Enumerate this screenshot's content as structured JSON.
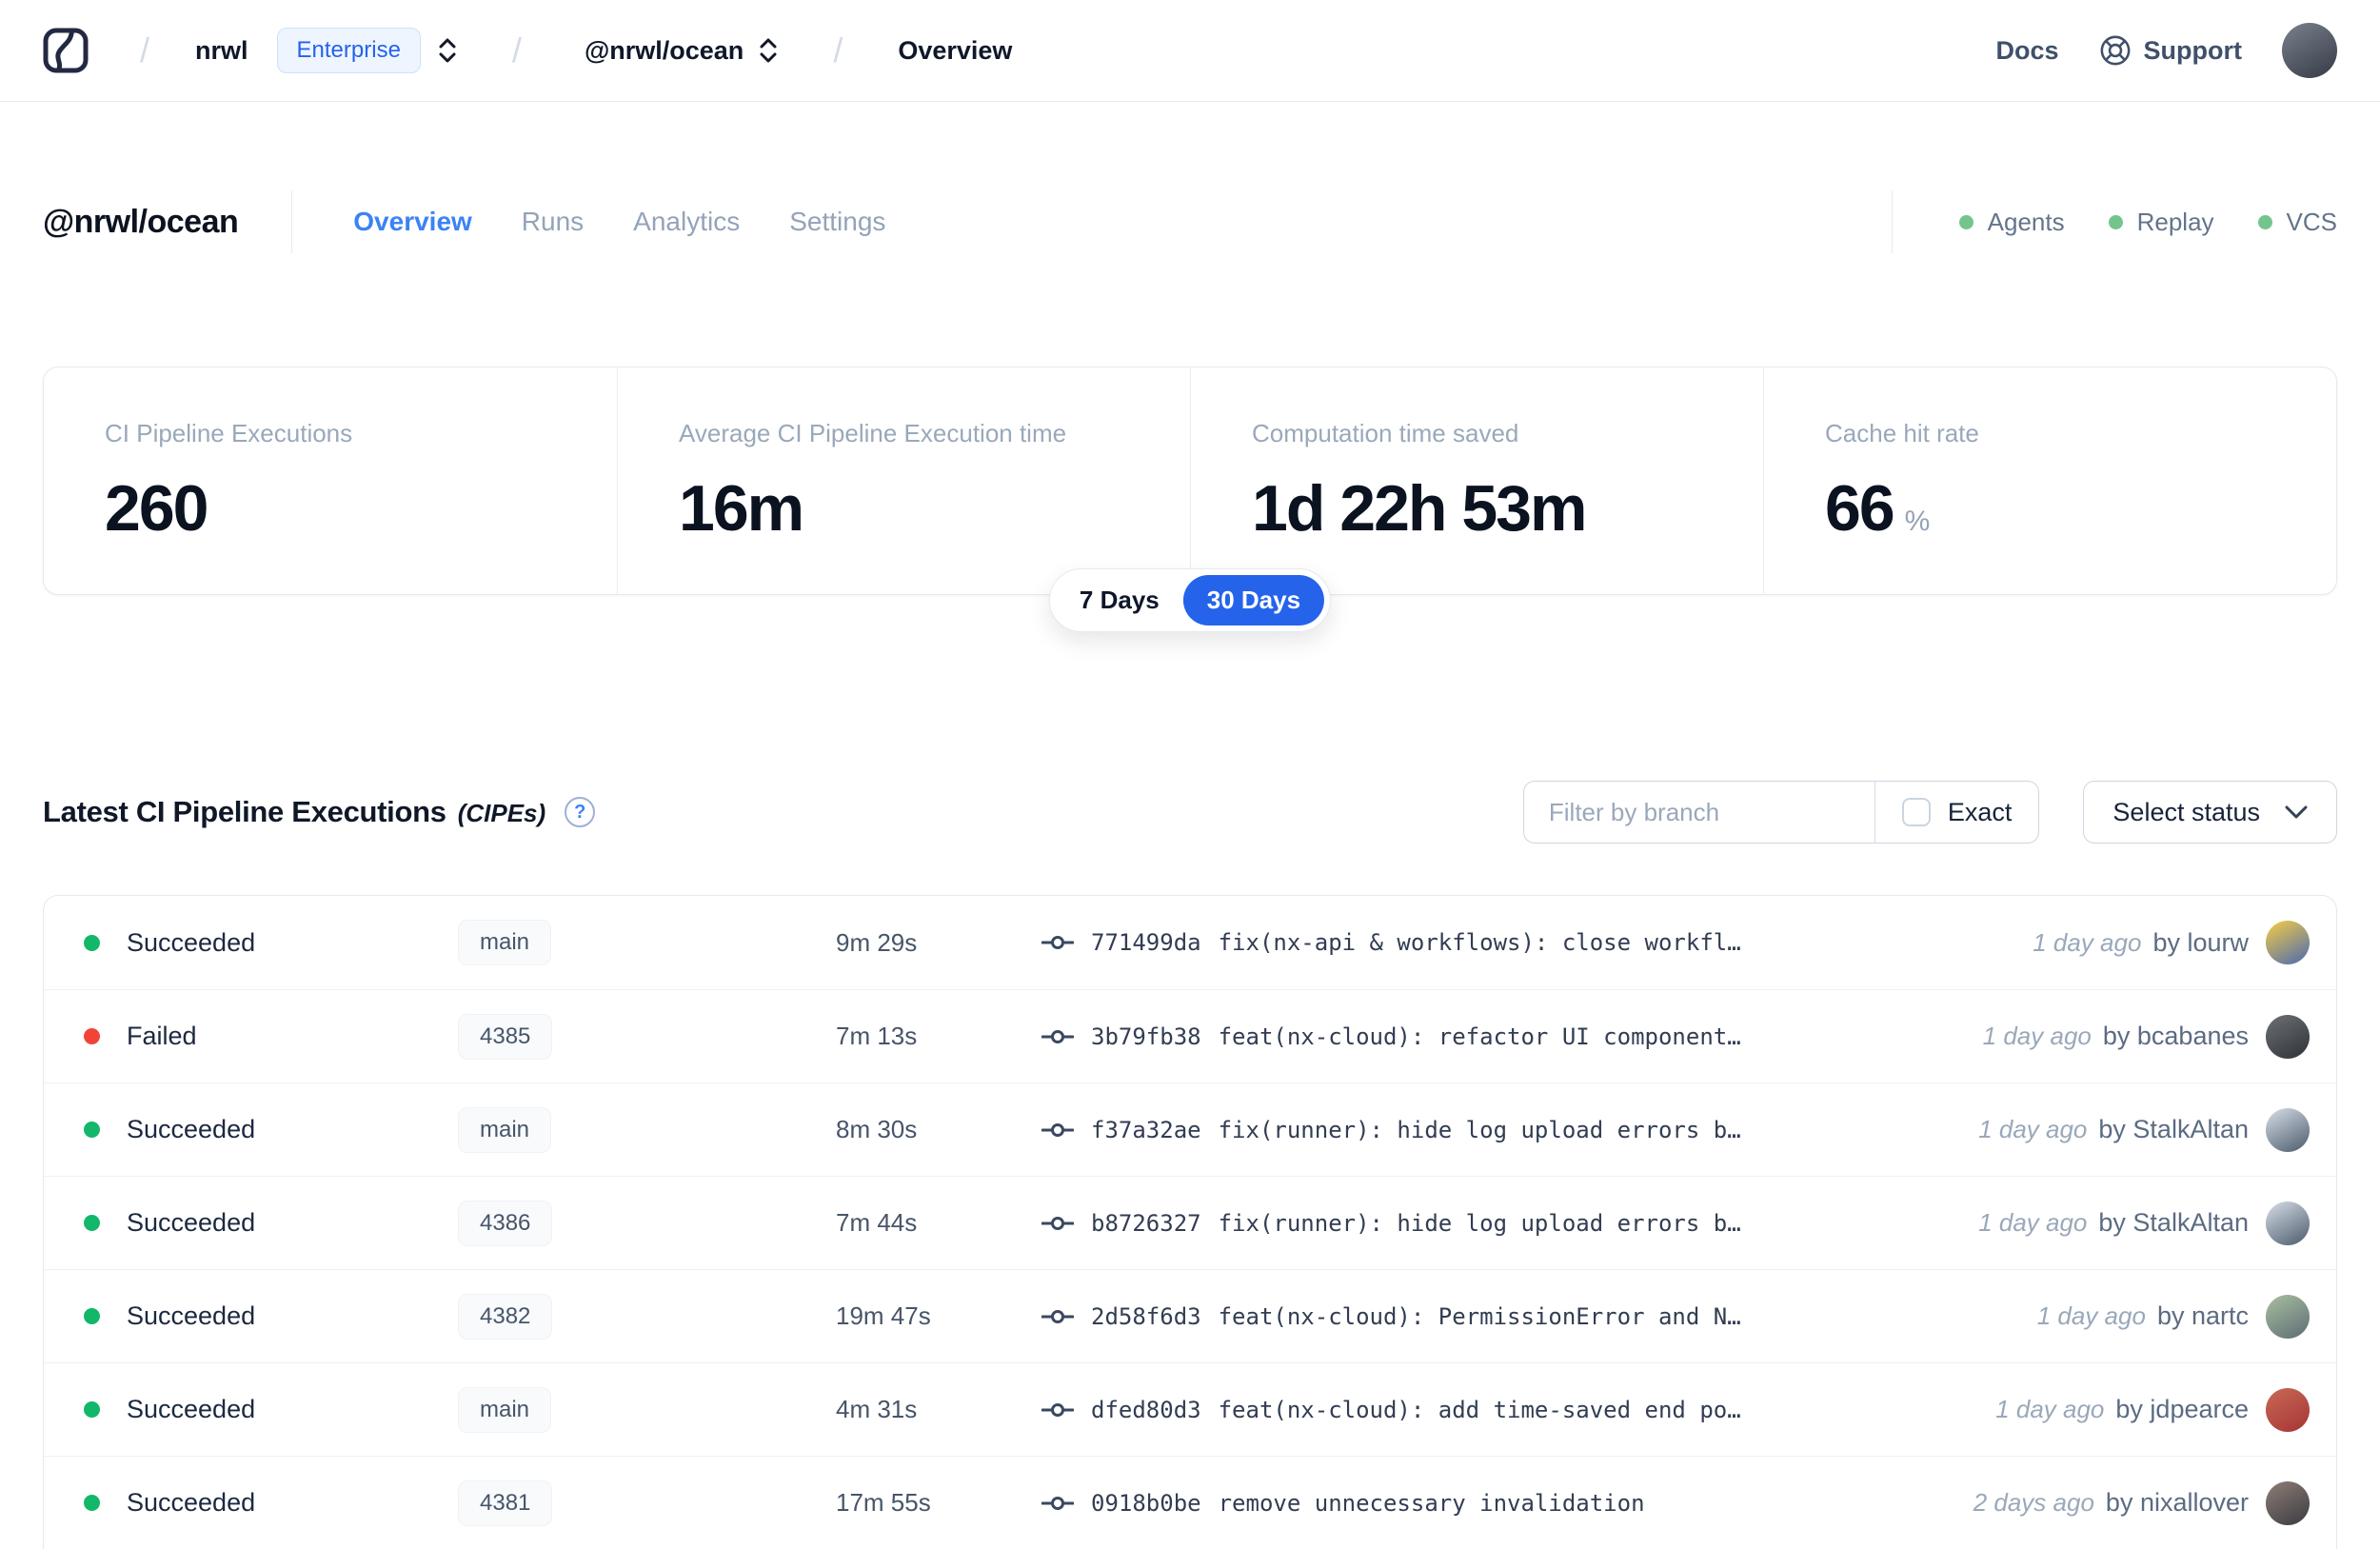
{
  "navbar": {
    "org": "nrwl",
    "plan_badge": "Enterprise",
    "workspace": "@nrwl/ocean",
    "page": "Overview",
    "docs_label": "Docs",
    "support_label": "Support",
    "avatar_colors": [
      "#7a828e",
      "#343a45"
    ]
  },
  "header": {
    "workspace_title": "@nrwl/ocean",
    "tabs": [
      {
        "label": "Overview",
        "active": true
      },
      {
        "label": "Runs",
        "active": false
      },
      {
        "label": "Analytics",
        "active": false
      },
      {
        "label": "Settings",
        "active": false
      }
    ],
    "status_indicators": [
      "Agents",
      "Replay",
      "VCS"
    ]
  },
  "stats": {
    "cards": [
      {
        "label": "CI Pipeline Executions",
        "value": "260"
      },
      {
        "label": "Average CI Pipeline Execution time",
        "value": "16m"
      },
      {
        "label": "Computation time saved",
        "value": "1d 22h 53m"
      },
      {
        "label": "Cache hit rate",
        "value": "66",
        "unit": "%"
      }
    ],
    "range_toggle": {
      "options": [
        "7 Days",
        "30 Days"
      ],
      "selected": "30 Days"
    }
  },
  "cipe_section": {
    "title": "Latest CI Pipeline Executions",
    "title_suffix": "(CIPEs)",
    "help_glyph": "?",
    "filter_placeholder": "Filter by branch",
    "exact_label": "Exact",
    "exact_checked": false,
    "select_status_label": "Select status"
  },
  "table": {
    "rows": [
      {
        "state": "succeeded",
        "status": "Succeeded",
        "branch": "main",
        "duration": "9m 29s",
        "hash": "771499da",
        "message": "fix(nx-api & workflows): close workfl…",
        "time_ago": "1 day ago",
        "author": "by lourw",
        "avatar_colors": [
          "#f7ce45",
          "#4a69b0"
        ]
      },
      {
        "state": "failed",
        "status": "Failed",
        "branch": "4385",
        "duration": "7m 13s",
        "hash": "3b79fb38",
        "message": "feat(nx-cloud): refactor UI component…",
        "time_ago": "1 day ago",
        "author": "by bcabanes",
        "avatar_colors": [
          "#6d6f75",
          "#2f3338"
        ]
      },
      {
        "state": "succeeded",
        "status": "Succeeded",
        "branch": "main",
        "duration": "8m 30s",
        "hash": "f37a32ae",
        "message": "fix(runner): hide log upload errors b…",
        "time_ago": "1 day ago",
        "author": "by StalkAltan",
        "avatar_colors": [
          "#d8dfe8",
          "#4b5a6b"
        ]
      },
      {
        "state": "succeeded",
        "status": "Succeeded",
        "branch": "4386",
        "duration": "7m 44s",
        "hash": "b8726327",
        "message": "fix(runner): hide log upload errors b…",
        "time_ago": "1 day ago",
        "author": "by StalkAltan",
        "avatar_colors": [
          "#d8dfe8",
          "#4b5a6b"
        ]
      },
      {
        "state": "succeeded",
        "status": "Succeeded",
        "branch": "4382",
        "duration": "19m 47s",
        "hash": "2d58f6d3",
        "message": "feat(nx-cloud): PermissionError and N…",
        "time_ago": "1 day ago",
        "author": "by nartc",
        "avatar_colors": [
          "#a9c0a1",
          "#5d6c74"
        ]
      },
      {
        "state": "succeeded",
        "status": "Succeeded",
        "branch": "main",
        "duration": "4m 31s",
        "hash": "dfed80d3",
        "message": "feat(nx-cloud): add time-saved end po…",
        "time_ago": "1 day ago",
        "author": "by jdpearce",
        "avatar_colors": [
          "#c96a55",
          "#a63434"
        ]
      },
      {
        "state": "succeeded",
        "status": "Succeeded",
        "branch": "4381",
        "duration": "17m 55s",
        "hash": "0918b0be",
        "message": "remove unnecessary invalidation",
        "time_ago": "2 days ago",
        "author": "by nixallover",
        "avatar_colors": [
          "#8d7f76",
          "#3c3a42"
        ]
      }
    ]
  },
  "colors": {
    "accent_blue": "#2563eb",
    "tab_active_blue": "#3b82f6",
    "succeeded": "#12b76a",
    "failed": "#f04438",
    "legend_dot": "#74c48d"
  }
}
